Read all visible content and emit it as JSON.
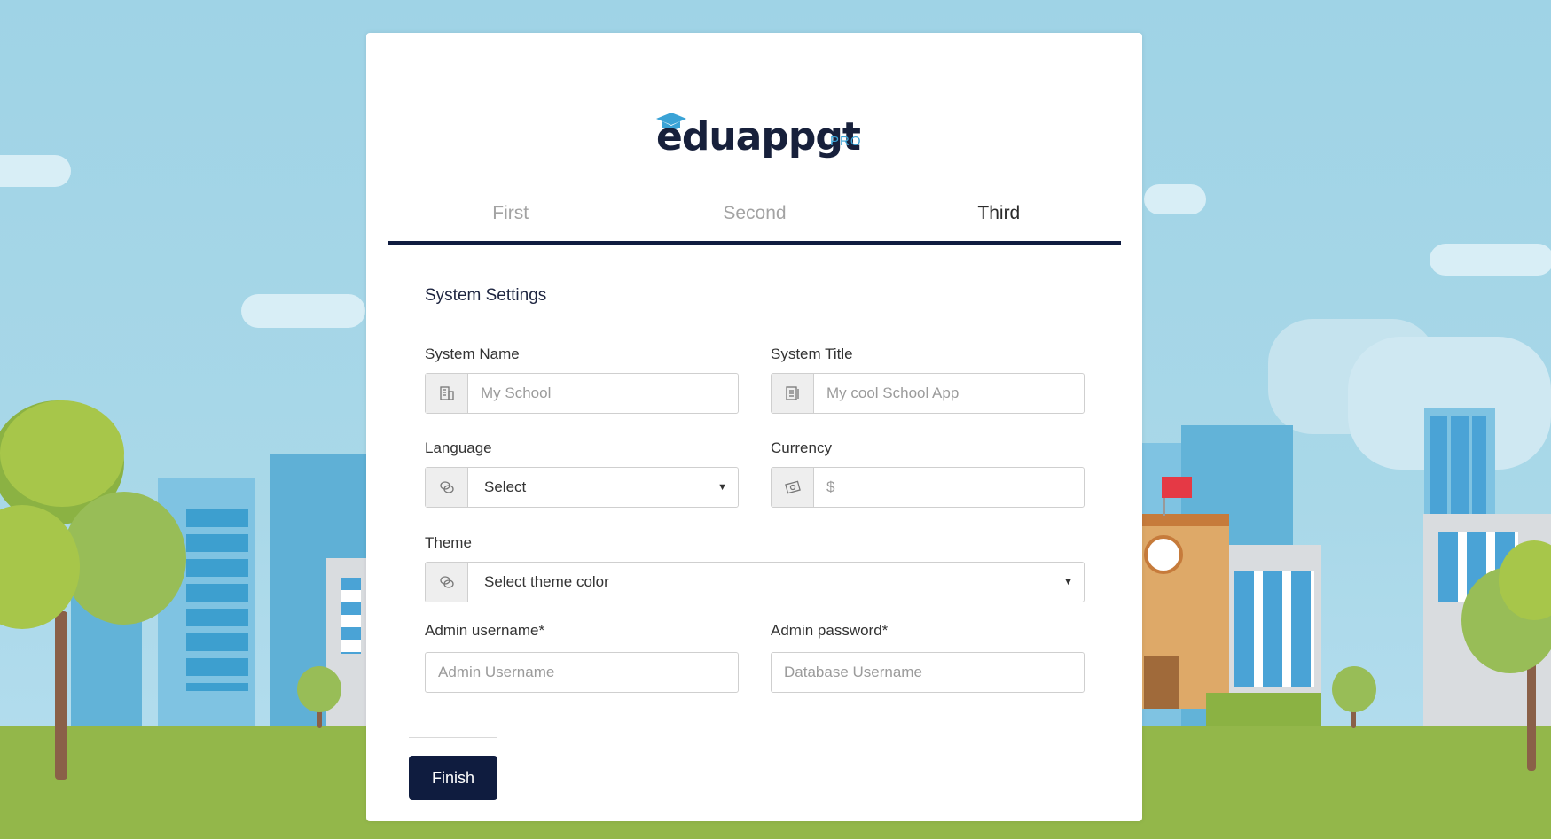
{
  "brand": {
    "name": "eduappgt",
    "badge": "PRO"
  },
  "tabs": [
    {
      "label": "First",
      "active": false
    },
    {
      "label": "Second",
      "active": false
    },
    {
      "label": "Third",
      "active": true
    }
  ],
  "section": {
    "title": "System Settings"
  },
  "form": {
    "system_name": {
      "label": "System Name",
      "placeholder": "My School",
      "icon": "building-icon"
    },
    "system_title": {
      "label": "System Title",
      "placeholder": "My cool School App",
      "icon": "document-icon"
    },
    "language": {
      "label": "Language",
      "value": "Select",
      "icon": "chat-icon"
    },
    "currency": {
      "label": "Currency",
      "placeholder": "$",
      "icon": "money-icon"
    },
    "theme": {
      "label": "Theme",
      "value": "Select theme color",
      "icon": "chat-icon"
    },
    "admin_username": {
      "label": "Admin username*",
      "placeholder": "Admin Username"
    },
    "admin_password": {
      "label": "Admin password*",
      "placeholder": "Database Username"
    }
  },
  "actions": {
    "finish_label": "Finish"
  },
  "colors": {
    "primary": "#0f1c3f",
    "accent": "#3aa3d6",
    "ground": "#93b74a",
    "sky": "#9fd3e6"
  }
}
